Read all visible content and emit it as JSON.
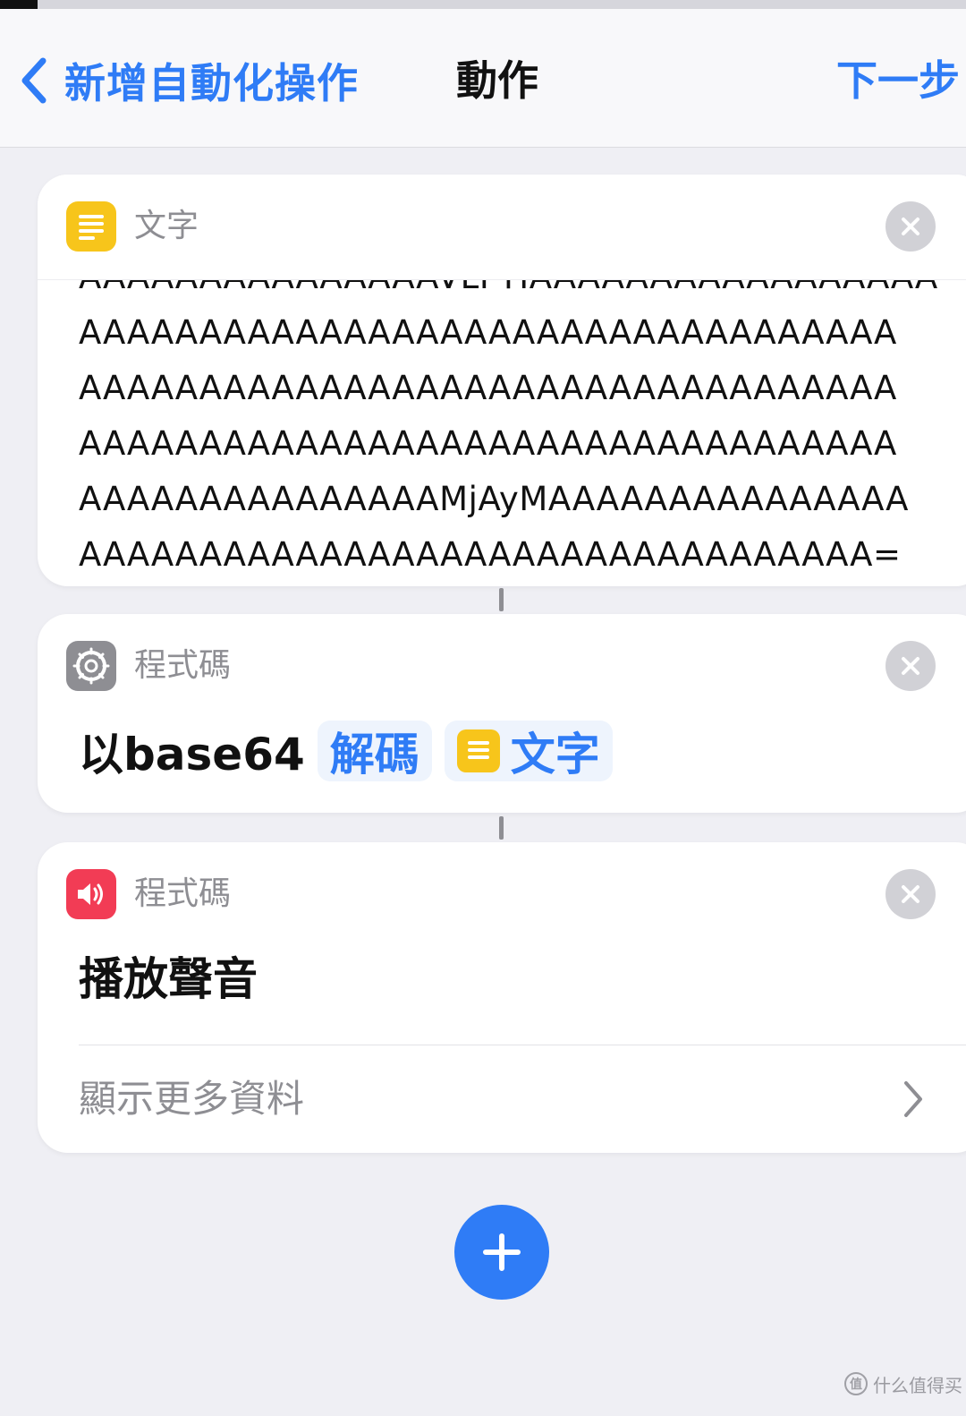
{
  "nav": {
    "back_label": "新增自動化操作",
    "title": "動作",
    "next_label": "下一步"
  },
  "text_action": {
    "label": "文字",
    "icon": "text-note-icon",
    "icon_color": "#f7c51b",
    "lines": [
      "AAAAAAAAAAAAAAAVLFTIAAAAAAAAAAAAAAAAA",
      "AAAAAAAAAAAAAAAAAAAAAAAAAAAAAAAAAA",
      "AAAAAAAAAAAAAAAAAAAAAAAAAAAAAAAAAA",
      "AAAAAAAAAAAAAAAAAAAAAAAAAAAAAAAAAA",
      "AAAAAAAAAAAAAAAMjAyMAAAAAAAAAAAAAAA",
      "AAAAAAAAAAAAAAAAAAAAAAAAAAAAAAAAA="
    ]
  },
  "decode_action": {
    "label": "程式碼",
    "icon": "gear-icon",
    "icon_color": "#8e8e93",
    "prefix": "以base64",
    "mode_token": "解碼",
    "input_token": "文字"
  },
  "sound_action": {
    "label": "程式碼",
    "icon": "speaker-icon",
    "icon_color": "#f23c55",
    "title": "播放聲音",
    "show_more": "顯示更多資料"
  },
  "watermark": "什么值得买",
  "colors": {
    "accent": "#2f7cf6",
    "background": "#efeff4"
  }
}
